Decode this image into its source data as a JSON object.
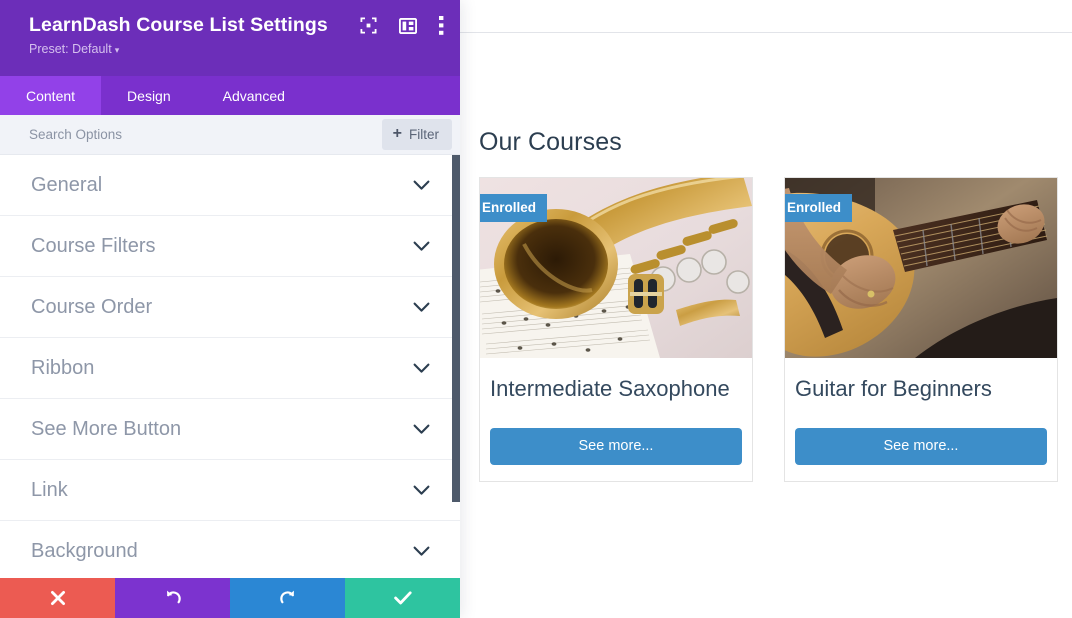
{
  "panel": {
    "title": "LearnDash Course List Settings",
    "preset_label": "Preset: Default",
    "preset_caret": "▾",
    "header_icons": [
      {
        "name": "focus-icon",
        "label": "Focus"
      },
      {
        "name": "layout-panel-icon",
        "label": "Layout"
      },
      {
        "name": "more-vertical-icon",
        "label": "More options"
      }
    ],
    "tabs": [
      {
        "label": "Content",
        "active": true
      },
      {
        "label": "Design",
        "active": false
      },
      {
        "label": "Advanced",
        "active": false
      }
    ],
    "search": {
      "value": "",
      "placeholder": "Search Options"
    },
    "filter_button": {
      "label": "Filter",
      "icon": "+"
    },
    "sections": [
      {
        "label": "General"
      },
      {
        "label": "Course Filters"
      },
      {
        "label": "Course Order"
      },
      {
        "label": "Ribbon"
      },
      {
        "label": "See More Button"
      },
      {
        "label": "Link"
      },
      {
        "label": "Background"
      }
    ],
    "actions": [
      {
        "name": "cancel-button",
        "icon": "x",
        "color": "#ec5b52"
      },
      {
        "name": "undo-button",
        "icon": "undo",
        "color": "#7c33cf"
      },
      {
        "name": "redo-button",
        "icon": "redo",
        "color": "#2b87d4"
      },
      {
        "name": "save-button",
        "icon": "check",
        "color": "#2ec4a0"
      }
    ]
  },
  "preview": {
    "heading": "Our Courses",
    "courses": [
      {
        "title": "Intermediate Saxophone",
        "badge": "Enrolled",
        "button_label": "See more...",
        "image": "saxophone-on-sheet-music"
      },
      {
        "title": "Guitar for Beginners",
        "badge": "Enrolled",
        "button_label": "See more...",
        "image": "person-playing-acoustic-guitar"
      }
    ]
  },
  "colors": {
    "panel_header": "#6c2eb9",
    "tab_bar": "#7a30cd",
    "tab_active": "#9241e8",
    "accent_blue": "#3d8ec9",
    "scrollbar": "#4e5a6b"
  }
}
